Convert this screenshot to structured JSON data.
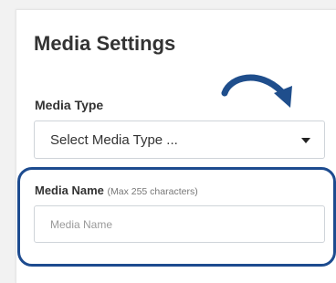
{
  "panel": {
    "title": "Media Settings"
  },
  "media_type": {
    "label": "Media Type",
    "selected_value": "Select Media Type ..."
  },
  "media_name": {
    "label": "Media Name",
    "hint": "(Max 255 characters)",
    "value": "",
    "placeholder": "Media Name"
  },
  "annotation": {
    "arrow_icon": "curved-arrow-icon",
    "highlight_color": "#1d4b8f"
  }
}
